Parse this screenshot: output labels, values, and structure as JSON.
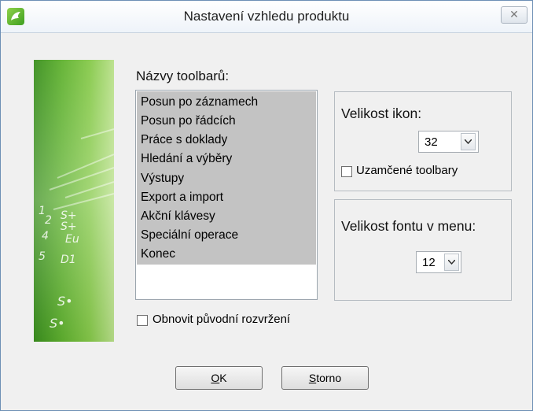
{
  "window": {
    "title": "Nastavení vzhledu produktu",
    "close_glyph": "✕"
  },
  "toolbars": {
    "label": "Názvy toolbarů:",
    "items": [
      "Posun po záznamech",
      "Posun po řádcích",
      "Práce s doklady",
      "Hledání a výběry",
      "Výstupy",
      "Export a import",
      "Akční klávesy",
      "Speciální operace",
      "Konec"
    ]
  },
  "icon_size": {
    "label": "Velikost ikon:",
    "value": "32"
  },
  "lock_toolbars": {
    "label": "Uzamčené toolbary",
    "checked": false
  },
  "menu_font": {
    "label": "Velikost fontu v menu:",
    "value": "12"
  },
  "restore_layout": {
    "label": "Obnovit původní rozvržení",
    "checked": false
  },
  "buttons": {
    "ok_mnemonic": "O",
    "ok_rest": "K",
    "cancel_mnemonic": "S",
    "cancel_rest": "torno"
  },
  "colors": {
    "banner_green": "#5fb12f",
    "selection_gray": "#c3c3c3"
  }
}
